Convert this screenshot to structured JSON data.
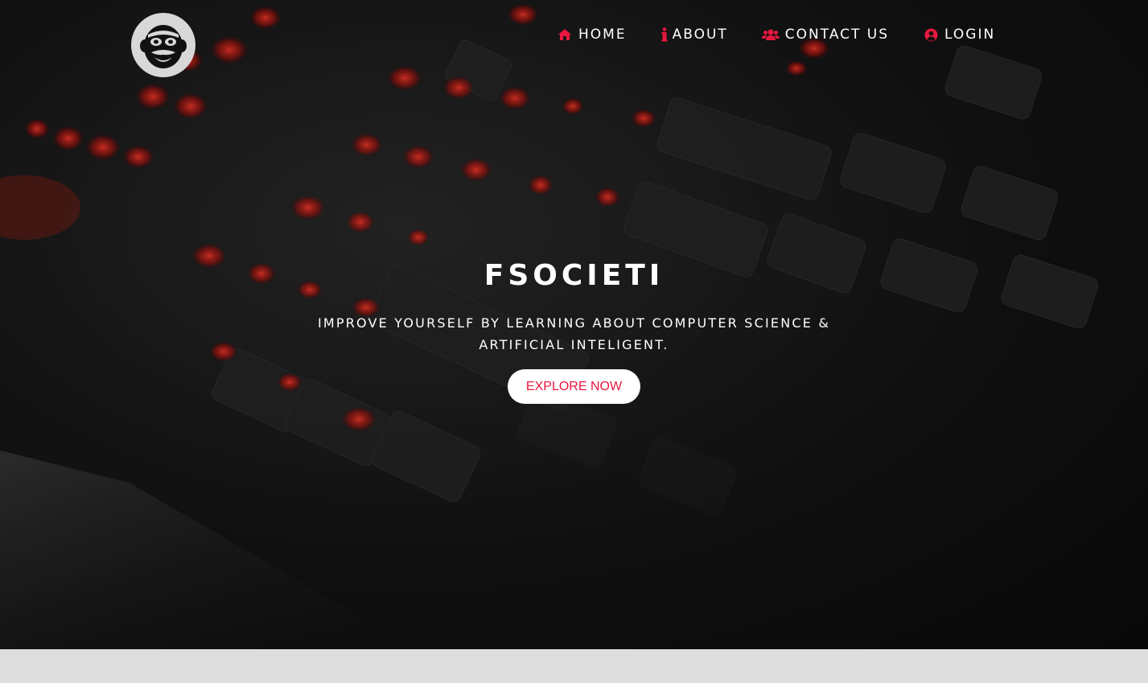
{
  "colors": {
    "accent": "#e8173f",
    "text_light": "#ffffff",
    "logo_bg": "#d8d8d8",
    "page_bg": "#dddddd"
  },
  "logo": {
    "icon": "mask-logo-icon"
  },
  "nav": {
    "items": [
      {
        "label": "HOME",
        "icon": "home-icon"
      },
      {
        "label": "ABOUT",
        "icon": "info-icon"
      },
      {
        "label": "CONTACT US",
        "icon": "users-icon"
      },
      {
        "label": "LOGIN",
        "icon": "user-circle-icon"
      }
    ]
  },
  "hero": {
    "title": "FSOCIETI",
    "subtitle": "IMPROVE YOURSELF BY LEARNING ABOUT COMPUTER SCIENCE & ARTIFICIAL INTELIGENT.",
    "button_label": "EXPLORE NOW"
  }
}
